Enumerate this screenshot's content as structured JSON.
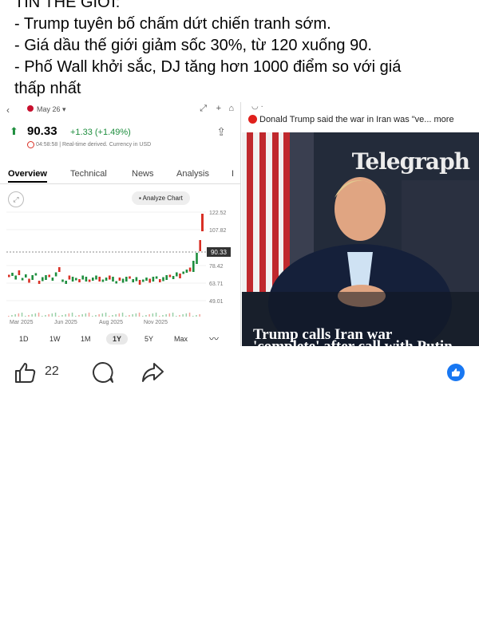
{
  "post": {
    "lines": [
      "TIN THẾ GIỚI:",
      "- Trump tuyên bố chấm dứt chiến tranh sớm.",
      "- Giá dầu thế giới giảm sốc 30%, từ 120 xuống 90.",
      "- Phố Wall khởi sắc, DJ tăng hơn 1000 điểm so với giá",
      "thấp nhất"
    ]
  },
  "stock": {
    "date": "May 26 ▾",
    "price": "90.33",
    "change": "+1.33 (+1.49%)",
    "meta": "04:58:58 | Real-time derived. Currency in USD",
    "tabs": [
      "Overview",
      "Technical",
      "News",
      "Analysis"
    ],
    "analyze_label": "Analyze Chart",
    "price_tag": "90.33",
    "y_ticks": [
      "122.52",
      "107.82",
      "78.42",
      "63.71",
      "49.01"
    ],
    "x_ticks": [
      "Mar 2025",
      "Jun 2025",
      "Aug 2025",
      "Nov 2025"
    ],
    "ranges": [
      "1D",
      "1W",
      "1M",
      "1Y",
      "5Y",
      "Max"
    ],
    "selected_range": "1Y",
    "colors": {
      "up": "#1e8e3e",
      "down": "#d93025"
    }
  },
  "news": {
    "caption": "Donald Trump said the war in Iran was \"ve... more",
    "brand": "Telegraph",
    "headline": "Trump calls Iran war",
    "headline2": "'complete' after call with Putin"
  },
  "reactions": {
    "like_count": "22",
    "colors": {
      "facebook_blue": "#1877f2"
    }
  }
}
